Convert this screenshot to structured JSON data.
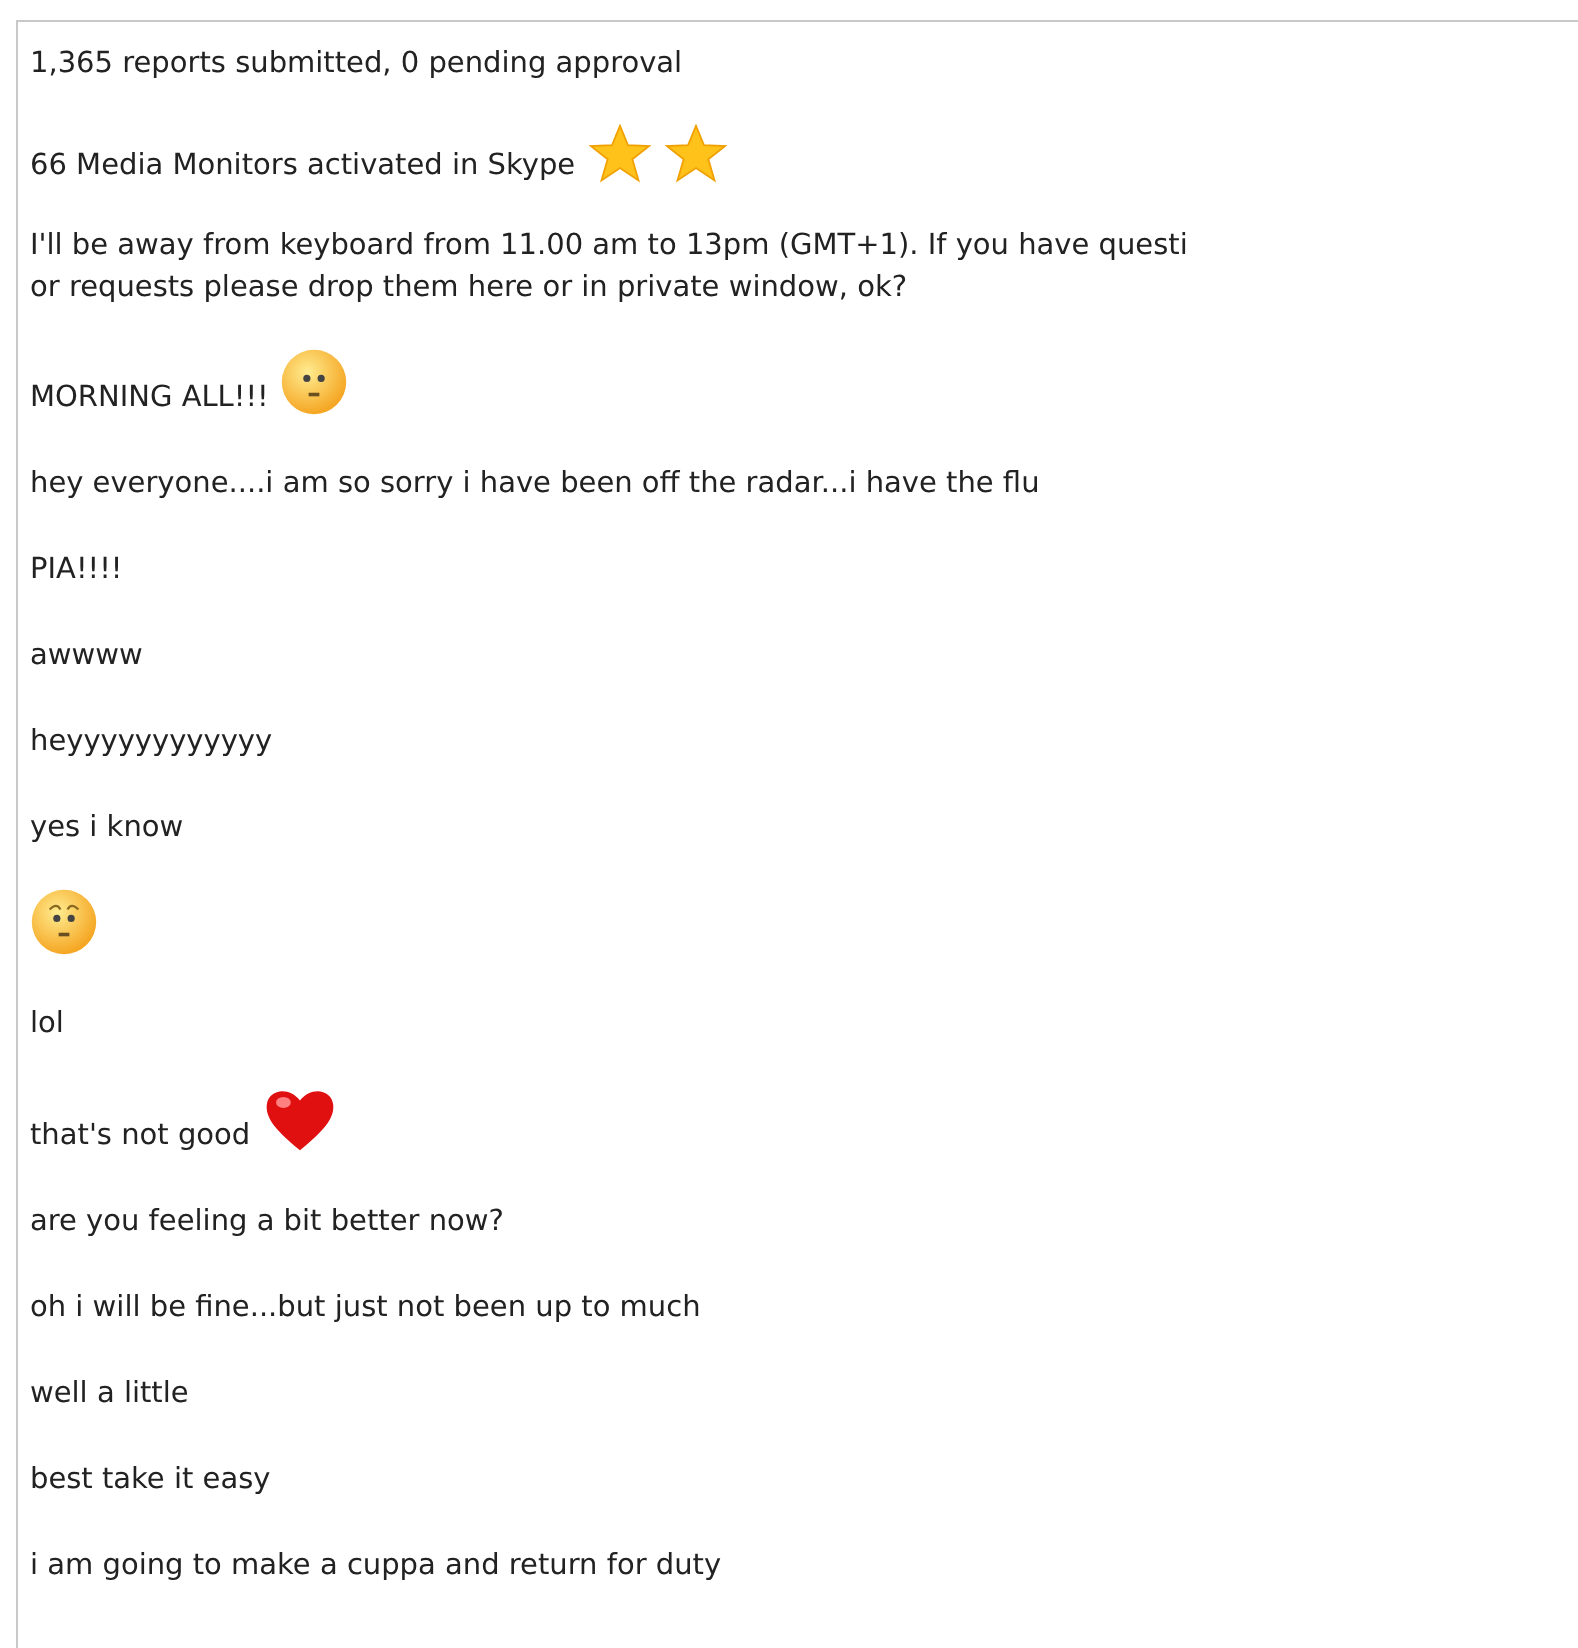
{
  "messages": [
    {
      "lines": [
        "1,365 reports submitted, 0 pending approval"
      ]
    },
    {
      "lines": [
        "66 Media Monitors activated in Skype"
      ],
      "icons": [
        {
          "kind": "star"
        },
        {
          "kind": "star"
        }
      ]
    },
    {
      "lines": [
        "I'll be away from keyboard from 11.00 am to 13pm (GMT+1). If you have questi",
        "or requests please drop them here or in private window, ok?"
      ]
    },
    {
      "lines": [
        "MORNING ALL!!!"
      ],
      "icons": [
        {
          "kind": "flat-face"
        }
      ]
    },
    {
      "lines": [
        "hey everyone....i am so sorry i have been off the radar...i have the flu"
      ]
    },
    {
      "lines": [
        "PIA!!!!"
      ]
    },
    {
      "lines": [
        "awwww"
      ]
    },
    {
      "lines": [
        "heyyyyyyyyyyyy"
      ]
    },
    {
      "lines": [
        "yes i know"
      ]
    },
    {
      "icons": [
        {
          "kind": "worried-face"
        }
      ]
    },
    {
      "lines": [
        "lol"
      ]
    },
    {
      "lines": [
        "that's not good"
      ],
      "icons": [
        {
          "kind": "heart"
        }
      ]
    },
    {
      "lines": [
        "are you feeling a bit better now?"
      ]
    },
    {
      "lines": [
        "oh i will be fine...but just not been up to much"
      ]
    },
    {
      "lines": [
        "well a little"
      ]
    },
    {
      "lines": [
        "best take it easy"
      ]
    },
    {
      "lines": [
        "i am going to make a cuppa and return for duty"
      ]
    }
  ]
}
